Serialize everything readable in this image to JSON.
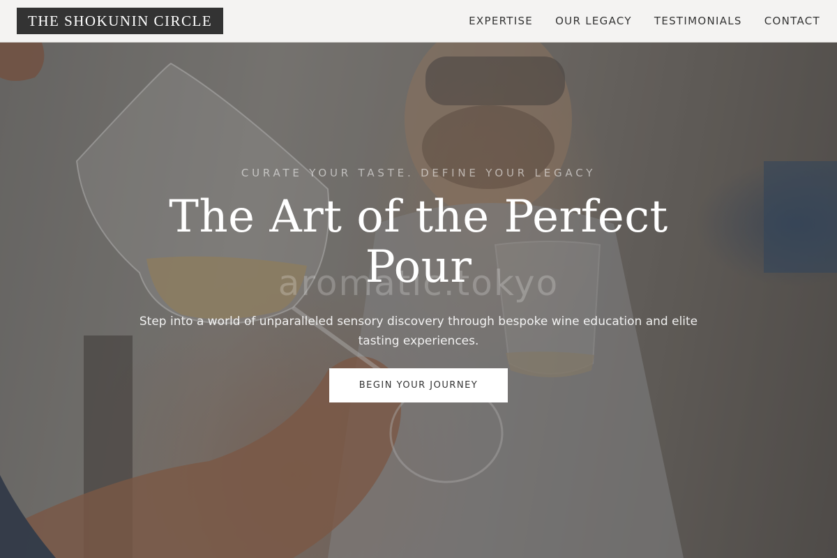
{
  "header": {
    "brand": "THE SHOKUNIN CIRCLE",
    "nav": [
      {
        "label": "EXPERTISE"
      },
      {
        "label": "OUR LEGACY"
      },
      {
        "label": "TESTIMONIALS"
      },
      {
        "label": "CONTACT"
      }
    ]
  },
  "hero": {
    "tagline": "CURATE YOUR TASTE. DEFINE YOUR LEGACY",
    "title": "The Art of the Perfect Pour",
    "watermark": "aromatic.tokyo",
    "subtitle": "Step into a world of unparalleled sensory discovery through bespoke wine education and elite tasting experiences.",
    "cta_label": "BEGIN YOUR JOURNEY"
  },
  "colors": {
    "header_bg": "#f4f3f2",
    "logo_bg": "#333333",
    "text_dark": "#333333",
    "cta_bg": "#ffffff"
  }
}
